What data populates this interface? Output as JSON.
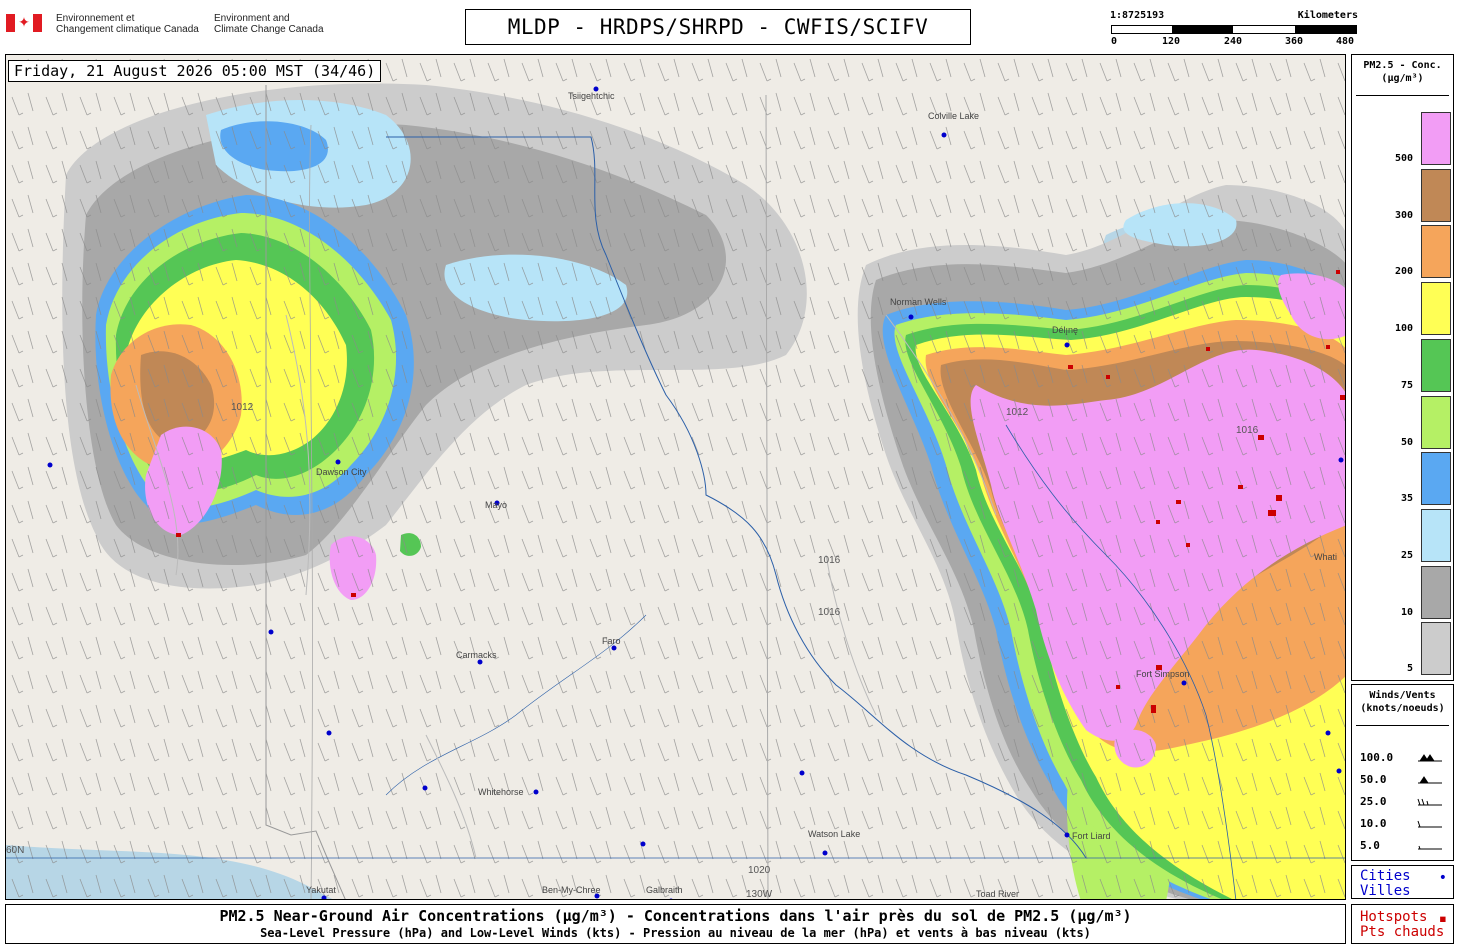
{
  "header": {
    "department_fr_line1": "Environnement et",
    "department_fr_line2": "Changement climatique Canada",
    "department_en_line1": "Environment and",
    "department_en_line2": "Climate Change Canada",
    "title": "MLDP - HRDPS/SHRPD - CWFIS/SCIFV",
    "flag_icon": "maple-leaf-icon"
  },
  "scale": {
    "ratio": "1:8725193",
    "units": "Kilometers",
    "ticks": [
      "0",
      "120",
      "240",
      "360",
      "480"
    ]
  },
  "map": {
    "timestamp": "Friday, 21 August 2026 05:00 MST (34/46)",
    "cities": [
      {
        "name": "Tsiigehtchic"
      },
      {
        "name": "Colville Lake"
      },
      {
        "name": "Norman Wells"
      },
      {
        "name": "Délı̨nę"
      },
      {
        "name": "Dawson City"
      },
      {
        "name": "Mayo"
      },
      {
        "name": "Carmacks"
      },
      {
        "name": "Faro"
      },
      {
        "name": "Whitehorse"
      },
      {
        "name": "Watson Lake"
      },
      {
        "name": "Fort Liard"
      },
      {
        "name": "Whati"
      },
      {
        "name": "Fort Simpson"
      },
      {
        "name": "Yakutat"
      },
      {
        "name": "Ben-My-Chree"
      },
      {
        "name": "Galbraith"
      },
      {
        "name": "Toad River"
      }
    ],
    "isobar_labels": [
      "1012",
      "1016",
      "1020"
    ],
    "meridian_label": "130W",
    "contour_label": "60N",
    "colors": {
      "land": "#efece6",
      "water": "#b7d6e6",
      "border": "#2b5fa8",
      "city_dot": "#0000cc",
      "hotspot": "#cc0000"
    }
  },
  "legend": {
    "title_line1": "PM2.5 - Conc.",
    "title_line2": "(µg/m³)",
    "bins": [
      {
        "label": "500",
        "color": "#f29df5"
      },
      {
        "label": "300",
        "color": "#c08856"
      },
      {
        "label": "200",
        "color": "#f5a55b"
      },
      {
        "label": "100",
        "color": "#ffff55"
      },
      {
        "label": "75",
        "color": "#55c655"
      },
      {
        "label": "50",
        "color": "#b5f065"
      },
      {
        "label": "35",
        "color": "#5aa8f2"
      },
      {
        "label": "25",
        "color": "#b7e4f8"
      },
      {
        "label": "10",
        "color": "#a8a8a8"
      },
      {
        "label": "5",
        "color": "#cccccc"
      }
    ]
  },
  "wind_legend": {
    "title_line1": "Winds/Vents",
    "title_line2": "(knots/noeuds)",
    "speeds": [
      "100.0",
      "50.0",
      "25.0",
      "10.0",
      "5.0"
    ]
  },
  "cities_legend": {
    "line1": "Cities",
    "line2": "Villes",
    "marker": "•"
  },
  "hotspots_legend": {
    "line1": "Hotspots",
    "line2": "Pts chauds",
    "marker": "▪"
  },
  "caption": {
    "line1": "PM2.5 Near-Ground Air Concentrations (µg/m³) - Concentrations dans l'air près du sol de PM2.5 (µg/m³)",
    "line2": "Sea-Level Pressure (hPa) and Low-Level Winds (kts) - Pression au niveau de la mer (hPa) et vents à bas niveau (kts)"
  }
}
